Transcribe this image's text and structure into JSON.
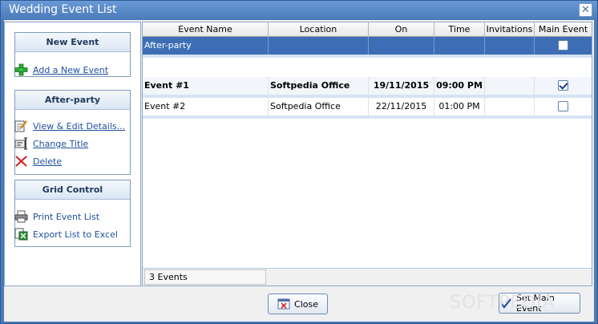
{
  "window": {
    "title": "Wedding Event List"
  },
  "left": {
    "groups": [
      {
        "header": "New Event",
        "items": [
          {
            "label": "Add a New Event",
            "icon": "plus-icon"
          }
        ]
      },
      {
        "header": "After-party",
        "items": [
          {
            "label": "View & Edit Details...",
            "icon": "edit-icon"
          },
          {
            "label": "Change Title",
            "icon": "rename-icon"
          },
          {
            "label": "Delete",
            "icon": "delete-icon"
          }
        ]
      },
      {
        "header": "Grid Control",
        "items": [
          {
            "label": "Print Event List",
            "icon": "printer-icon"
          },
          {
            "label": "Export List to Excel",
            "icon": "excel-icon"
          }
        ]
      }
    ]
  },
  "grid": {
    "columns": [
      "Event Name",
      "Location",
      "On",
      "Time",
      "Invitations",
      "Main Event"
    ],
    "rows": [
      {
        "name": "After-party",
        "location": "",
        "on": "",
        "time": "",
        "invitations": "",
        "main": false
      },
      {
        "name": "Event #1",
        "location": "Softpedia Office",
        "on": "19/11/2015",
        "time": "09:00 PM",
        "invitations": "",
        "main": true
      },
      {
        "name": "Event #2",
        "location": "Softpedia Office",
        "on": "22/11/2015",
        "time": "01:00 PM",
        "invitations": "",
        "main": false
      }
    ],
    "status": "3 Events"
  },
  "buttons": {
    "close": "Close",
    "set_main": "Set Main Event"
  },
  "watermark": "SOFTPEDIA",
  "colors": {
    "title_bar": "#4a7ab7",
    "selection": "#3d6eb5",
    "link": "#1e4f9c"
  }
}
